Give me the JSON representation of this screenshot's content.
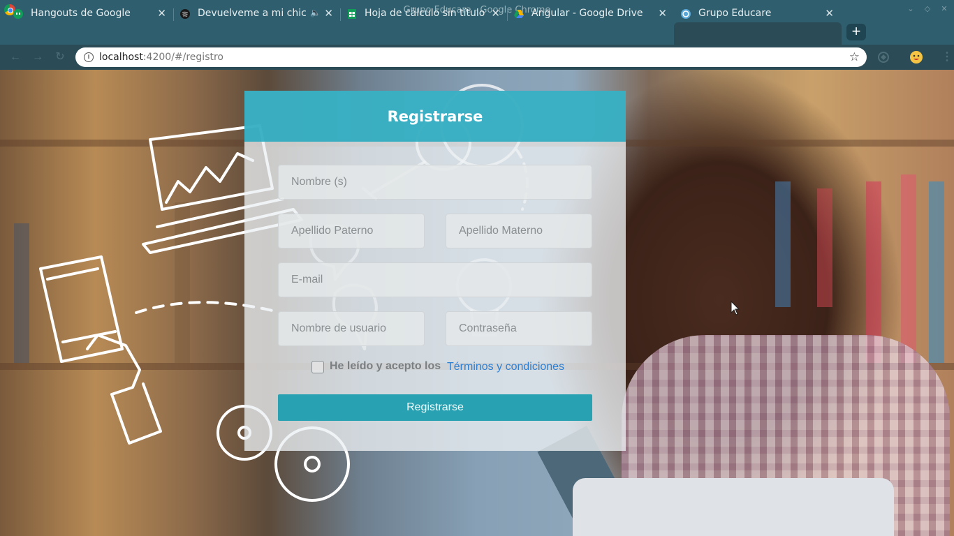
{
  "window": {
    "title": "Grupo Educare - Google Chrome"
  },
  "tabs": [
    {
      "label": "Hangouts de Google",
      "icon": "hangouts-icon"
    },
    {
      "label": "Devuelveme a mi chica · H",
      "icon": "spotify-icon",
      "audio_icon": "speaker-icon"
    },
    {
      "label": "Hoja de cálculo sin título - Ho",
      "icon": "sheets-icon"
    },
    {
      "label": "Angular - Google Drive",
      "icon": "drive-icon"
    },
    {
      "label": "Grupo Educare",
      "icon": "educare-icon",
      "active": true
    }
  ],
  "toolbar": {
    "url_host": "localhost",
    "url_path": ":4200/#/registro"
  },
  "form": {
    "title": "Registrarse",
    "nombre_placeholder": "Nombre (s)",
    "apellido_paterno_placeholder": "Apellido Paterno",
    "apellido_materno_placeholder": "Apellido Materno",
    "email_placeholder": "E-mail",
    "usuario_placeholder": "Nombre de usuario",
    "password_placeholder": "Contraseña",
    "terms_text": "He leído y acepto los",
    "terms_link": "Términos y condiciones",
    "submit_label": "Registrarse"
  },
  "colors": {
    "accent": "#28a2b2",
    "header": "#26a8be",
    "link": "#2d7fd2"
  }
}
